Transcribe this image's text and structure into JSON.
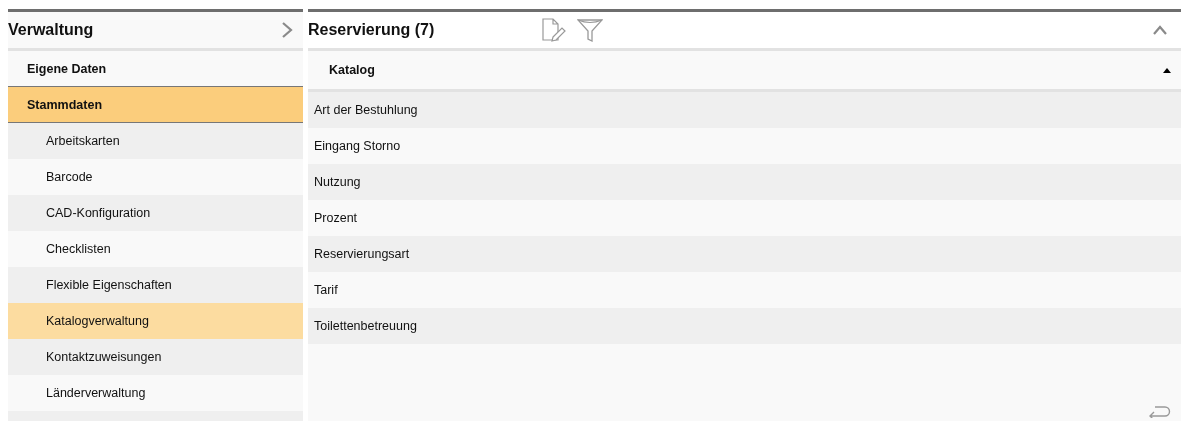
{
  "sidebar": {
    "title": "Verwaltung",
    "items": [
      {
        "label": "Eigene Daten",
        "selected": false
      },
      {
        "label": "Stammdaten",
        "selected": true,
        "children": [
          {
            "label": "Arbeitskarten",
            "selected": false
          },
          {
            "label": "Barcode",
            "selected": false
          },
          {
            "label": "CAD-Konfiguration",
            "selected": false
          },
          {
            "label": "Checklisten",
            "selected": false
          },
          {
            "label": "Flexible Eigenschaften",
            "selected": false
          },
          {
            "label": "Katalogverwaltung",
            "selected": true
          },
          {
            "label": "Kontaktzuweisungen",
            "selected": false
          },
          {
            "label": "Länderverwaltung",
            "selected": false
          }
        ]
      }
    ]
  },
  "panel": {
    "title": "Reservierung (7)",
    "table": {
      "columns": [
        {
          "label": "Katalog",
          "sort_ascending": true
        }
      ],
      "rows": [
        {
          "cells": [
            "Art der Bestuhlung"
          ]
        },
        {
          "cells": [
            "Eingang Storno"
          ]
        },
        {
          "cells": [
            "Nutzung"
          ]
        },
        {
          "cells": [
            "Prozent"
          ]
        },
        {
          "cells": [
            "Reservierungsart"
          ]
        },
        {
          "cells": [
            "Tarif"
          ]
        },
        {
          "cells": [
            "Toilettenbetreuung"
          ]
        }
      ]
    }
  }
}
